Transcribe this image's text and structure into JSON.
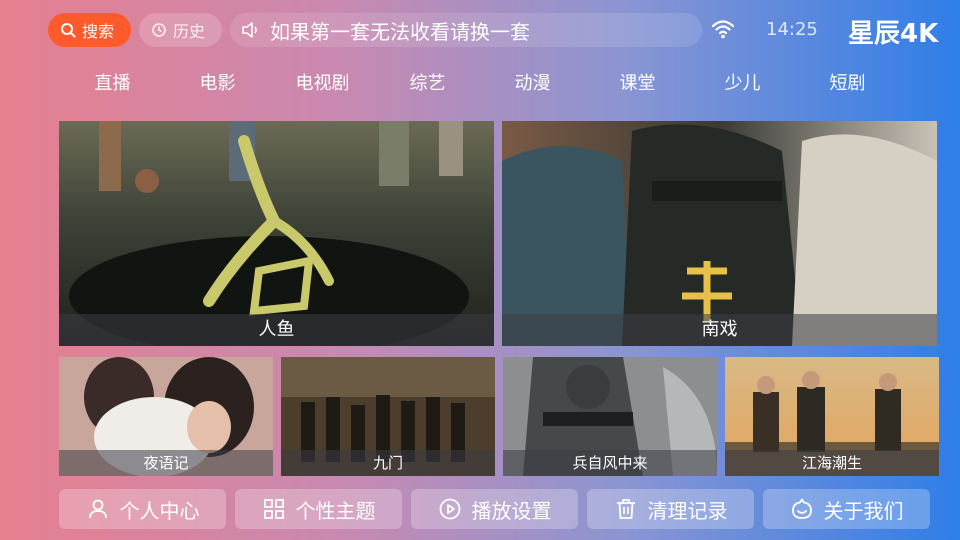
{
  "header": {
    "search_label": "搜索",
    "history_label": "历史",
    "notice": "如果第一套无法收看请换一套",
    "time": "14:25",
    "brand": "星辰4K"
  },
  "categories": [
    "直播",
    "电影",
    "电视剧",
    "综艺",
    "动漫",
    "课堂",
    "少儿",
    "短剧"
  ],
  "featured": [
    {
      "title": "人鱼",
      "calligraphy": "人鱼"
    },
    {
      "title": "南戏",
      "calligraphy": "南"
    }
  ],
  "recommended": [
    {
      "title": "夜语记"
    },
    {
      "title": "九门"
    },
    {
      "title": "兵自风中来"
    },
    {
      "title": "江海潮生"
    }
  ],
  "bottom_bar": [
    {
      "label": "个人中心",
      "icon": "user-icon"
    },
    {
      "label": "个性主题",
      "icon": "grid-icon"
    },
    {
      "label": "播放设置",
      "icon": "play-icon"
    },
    {
      "label": "清理记录",
      "icon": "trash-icon"
    },
    {
      "label": "关于我们",
      "icon": "smiley-icon"
    }
  ],
  "colors": {
    "search_accent": "#ff5a2b",
    "background_left": "#e67f8f",
    "background_right": "#2f7ee8"
  }
}
